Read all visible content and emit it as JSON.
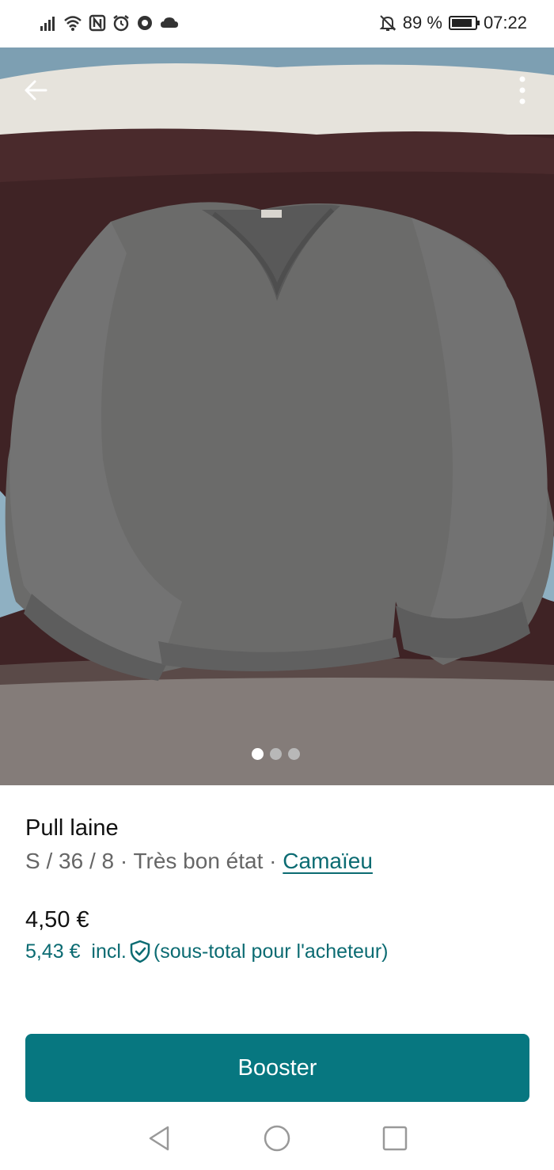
{
  "status_bar": {
    "battery_percent": "89 %",
    "battery_level": 0.89,
    "time": "07:22",
    "icons": [
      "signal-icon",
      "wifi-icon",
      "nfc-icon",
      "alarm-icon",
      "vpn-icon",
      "cloud-icon",
      "bell-off-icon",
      "battery-icon"
    ]
  },
  "photo": {
    "back_icon": "arrow-left-icon",
    "more_icon": "more-vertical-icon",
    "image_count": 3,
    "active_index": 0
  },
  "item": {
    "title": "Pull laine",
    "meta_prefix": "S / 36 / 8 · Très bon état · ",
    "brand": "Camaïeu",
    "price": "4,50 €",
    "total_price": "5,43 €",
    "incl_label": "incl.",
    "buyer_note": "(sous-total pour l'acheteur)"
  },
  "actions": {
    "booster_label": "Booster"
  },
  "colors": {
    "accent": "#077780",
    "link": "#0b6b72",
    "muted_text": "#666666"
  },
  "nav": {
    "icons": [
      "back-triangle-icon",
      "home-circle-icon",
      "recents-square-icon"
    ]
  }
}
